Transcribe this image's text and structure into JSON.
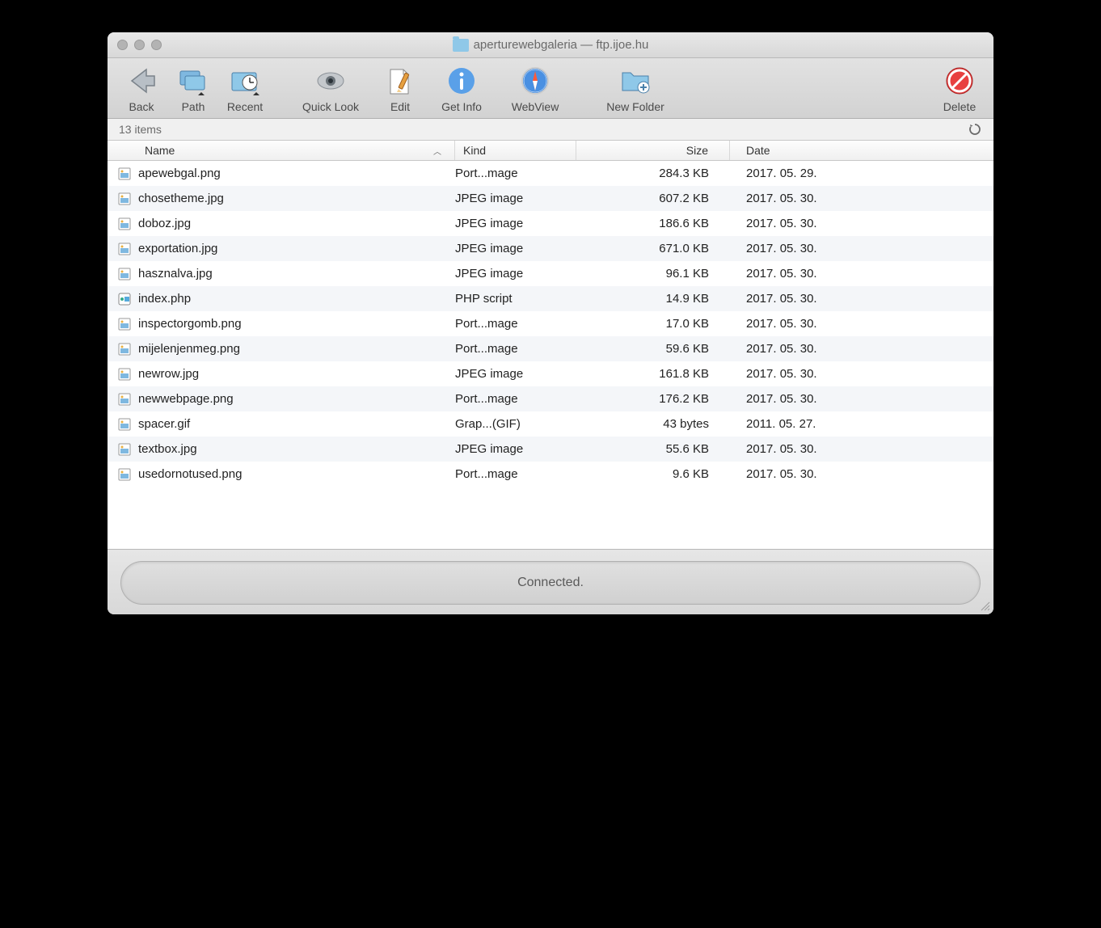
{
  "window": {
    "title": "aperturewebgaleria — ftp.ijoe.hu"
  },
  "toolbar": {
    "back": "Back",
    "path": "Path",
    "recent": "Recent",
    "quicklook": "Quick Look",
    "edit": "Edit",
    "getinfo": "Get Info",
    "webview": "WebView",
    "newfolder": "New Folder",
    "delete": "Delete"
  },
  "status": {
    "item_count": "13 items"
  },
  "columns": {
    "name": "Name",
    "kind": "Kind",
    "size": "Size",
    "date": "Date"
  },
  "files": [
    {
      "name": "apewebgal.png",
      "kind": "Port...mage",
      "size": "284.3 KB",
      "date": "2017. 05. 29.",
      "icon": "img"
    },
    {
      "name": "chosetheme.jpg",
      "kind": "JPEG image",
      "size": "607.2 KB",
      "date": "2017. 05. 30.",
      "icon": "img"
    },
    {
      "name": "doboz.jpg",
      "kind": "JPEG image",
      "size": "186.6 KB",
      "date": "2017. 05. 30.",
      "icon": "img"
    },
    {
      "name": "exportation.jpg",
      "kind": "JPEG image",
      "size": "671.0 KB",
      "date": "2017. 05. 30.",
      "icon": "img"
    },
    {
      "name": "hasznalva.jpg",
      "kind": "JPEG image",
      "size": "96.1 KB",
      "date": "2017. 05. 30.",
      "icon": "img"
    },
    {
      "name": "index.php",
      "kind": "PHP script",
      "size": "14.9 KB",
      "date": "2017. 05. 30.",
      "icon": "php"
    },
    {
      "name": "inspectorgomb.png",
      "kind": "Port...mage",
      "size": "17.0 KB",
      "date": "2017. 05. 30.",
      "icon": "img"
    },
    {
      "name": "mijelenjenmeg.png",
      "kind": "Port...mage",
      "size": "59.6 KB",
      "date": "2017. 05. 30.",
      "icon": "img"
    },
    {
      "name": "newrow.jpg",
      "kind": "JPEG image",
      "size": "161.8 KB",
      "date": "2017. 05. 30.",
      "icon": "img"
    },
    {
      "name": "newwebpage.png",
      "kind": "Port...mage",
      "size": "176.2 KB",
      "date": "2017. 05. 30.",
      "icon": "img"
    },
    {
      "name": "spacer.gif",
      "kind": "Grap...(GIF)",
      "size": "43 bytes",
      "date": "2011. 05. 27.",
      "icon": "img"
    },
    {
      "name": "textbox.jpg",
      "kind": "JPEG image",
      "size": "55.6 KB",
      "date": "2017. 05. 30.",
      "icon": "img"
    },
    {
      "name": "usedornotused.png",
      "kind": "Port...mage",
      "size": "9.6 KB",
      "date": "2017. 05. 30.",
      "icon": "img"
    }
  ],
  "footer": {
    "status": "Connected."
  }
}
